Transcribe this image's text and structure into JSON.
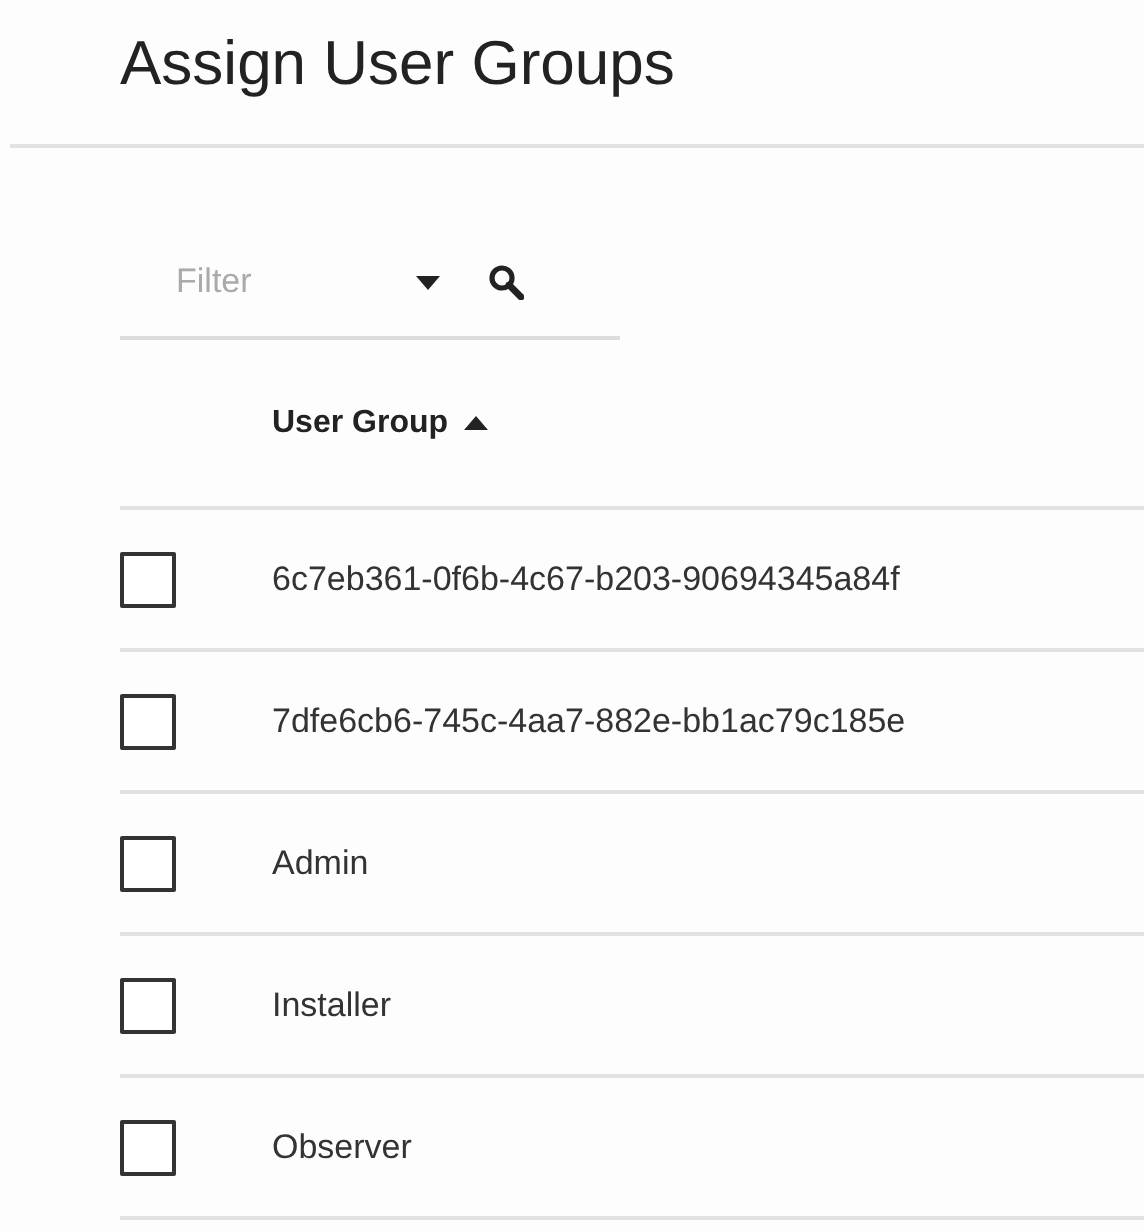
{
  "title": "Assign User Groups",
  "filter": {
    "placeholder": "Filter"
  },
  "table": {
    "columns": [
      {
        "label": "User Group",
        "sort_ascending": true
      }
    ],
    "rows": [
      {
        "name": "6c7eb361-0f6b-4c67-b203-90694345a84f",
        "checked": false
      },
      {
        "name": "7dfe6cb6-745c-4aa7-882e-bb1ac79c185e",
        "checked": false
      },
      {
        "name": "Admin",
        "checked": false
      },
      {
        "name": "Installer",
        "checked": false
      },
      {
        "name": "Observer",
        "checked": false
      }
    ]
  }
}
